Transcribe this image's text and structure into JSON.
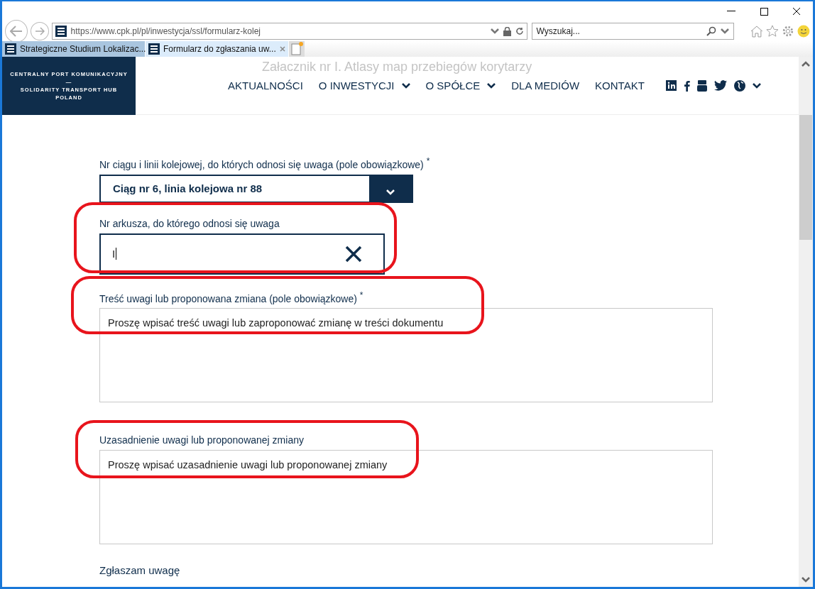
{
  "browser": {
    "url": "https://www.cpk.pl/pl/inwestycja/ssl/formularz-kolej",
    "search": {
      "placeholder": "Wyszukaj..."
    },
    "tabs": [
      {
        "label": "Strategiczne Studium Lokalizac...",
        "selected": false
      },
      {
        "label": "Formularz do zgłaszania uw...",
        "selected": true
      }
    ]
  },
  "site": {
    "logo": [
      "CENTRALNY PORT KOMUNIKACYJNY",
      "—",
      "SOLIDARITY TRANSPORT HUB",
      "POLAND"
    ],
    "faded_title": "Załacznik nr I. Atlasy map przebiegów korytarzy",
    "nav": [
      {
        "label": "AKTUALNOŚCI",
        "dropdown": false
      },
      {
        "label": "O INWESTYCJI",
        "dropdown": true
      },
      {
        "label": "O SPÓŁCE",
        "dropdown": true
      },
      {
        "label": "DLA MEDIÓW",
        "dropdown": false
      },
      {
        "label": "KONTAKT",
        "dropdown": false
      }
    ]
  },
  "form": {
    "fields": [
      {
        "kind": "select",
        "label": "Nr ciągu i linii kolejowej, do których odnosi się uwaga (pole obowiązkowe)",
        "required": true,
        "value": "Ciąg nr 6, linia kolejowa nr 88",
        "highlighted": false
      },
      {
        "kind": "input",
        "label": "Nr arkusza, do którego odnosi się uwaga",
        "required": false,
        "value": "I",
        "highlighted": true
      },
      {
        "kind": "textarea",
        "label": "Treść uwagi lub proponowana zmiana (pole obowiązkowe)",
        "required": true,
        "placeholder": "Proszę wpisać treść uwagi lub zaproponować zmianę w treści dokumentu",
        "highlighted": true
      },
      {
        "kind": "textarea",
        "label": "Uzasadnienie uwagi lub proponowanej zmiany",
        "required": false,
        "placeholder": "Proszę wpisać uzasadnienie uwagi lub proponowanej zmiany",
        "highlighted": true
      }
    ],
    "required_mark": "*",
    "section_label": "Zgłaszam uwagę"
  }
}
